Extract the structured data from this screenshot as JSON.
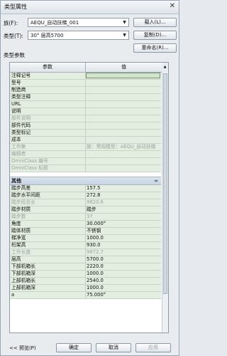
{
  "window": {
    "title": "类型属性",
    "close_glyph": "✕"
  },
  "top": {
    "family_label": "族(F):",
    "family_value": "AEQU_自动扶梯_001",
    "type_label": "类型(T):",
    "type_value": "30° 层高5700",
    "load_button": "载入(L)...",
    "duplicate_button": "复制(D)...",
    "rename_button": "重命名(R)..."
  },
  "params_section_title": "类型参数",
  "grid": {
    "header_param": "参数",
    "header_value": "值",
    "rows_top": [
      {
        "name": "注释记号",
        "value": "",
        "gray": false,
        "editing": true
      },
      {
        "name": "型号",
        "value": "",
        "gray": false
      },
      {
        "name": "制造商",
        "value": "",
        "gray": false
      },
      {
        "name": "类型注释",
        "value": "",
        "gray": false
      },
      {
        "name": "URL",
        "value": "",
        "gray": false
      },
      {
        "name": "说明",
        "value": "",
        "gray": false
      },
      {
        "name": "部件说明",
        "value": "",
        "gray": true
      },
      {
        "name": "部件代码",
        "value": "",
        "gray": false
      },
      {
        "name": "类型标记",
        "value": "",
        "gray": false
      },
      {
        "name": "成本",
        "value": "",
        "gray": false
      },
      {
        "name": "工作集",
        "value": "族：常规模型：AEQU_自动扶梯",
        "gray": true
      },
      {
        "name": "编辑者",
        "value": "",
        "gray": true
      },
      {
        "name": "OmniClass 编号",
        "value": "",
        "gray": true
      },
      {
        "name": "OmniClass 标题",
        "value": "",
        "gray": true
      }
    ],
    "group_name": "其他",
    "group_toggle": "≈",
    "rows_other": [
      {
        "name": "踏步高差",
        "value": "157.5",
        "gray": false
      },
      {
        "name": "踏步水平间距",
        "value": "272.8",
        "gray": false
      },
      {
        "name": "踏步段总长",
        "value": "9820.6",
        "gray": true
      },
      {
        "name": "踏步材质",
        "value": "踏步",
        "gray": false
      },
      {
        "name": "踏步数",
        "value": "37",
        "gray": true
      },
      {
        "name": "角度",
        "value": "30.000°",
        "gray": false
      },
      {
        "name": "踏体材质",
        "value": "不锈钢",
        "gray": false
      },
      {
        "name": "梯净宽",
        "value": "1000.0",
        "gray": false
      },
      {
        "name": "桁架高",
        "value": "930.0",
        "gray": false
      },
      {
        "name": "工作长度",
        "value": "9872.7",
        "gray": true
      },
      {
        "name": "层高",
        "value": "5700.0",
        "gray": false
      },
      {
        "name": "下部机箱长",
        "value": "2220.0",
        "gray": false
      },
      {
        "name": "下部机箱深",
        "value": "1000.0",
        "gray": false
      },
      {
        "name": "上部机箱长",
        "value": "2540.0",
        "gray": false
      },
      {
        "name": "上部机箱深",
        "value": "1000.0",
        "gray": false
      },
      {
        "name": "a",
        "value": "75.000°",
        "gray": false
      }
    ]
  },
  "footer": {
    "preview_button": "<< 预览(P)",
    "ok_button": "确定",
    "cancel_button": "取消",
    "apply_button": "应用"
  }
}
